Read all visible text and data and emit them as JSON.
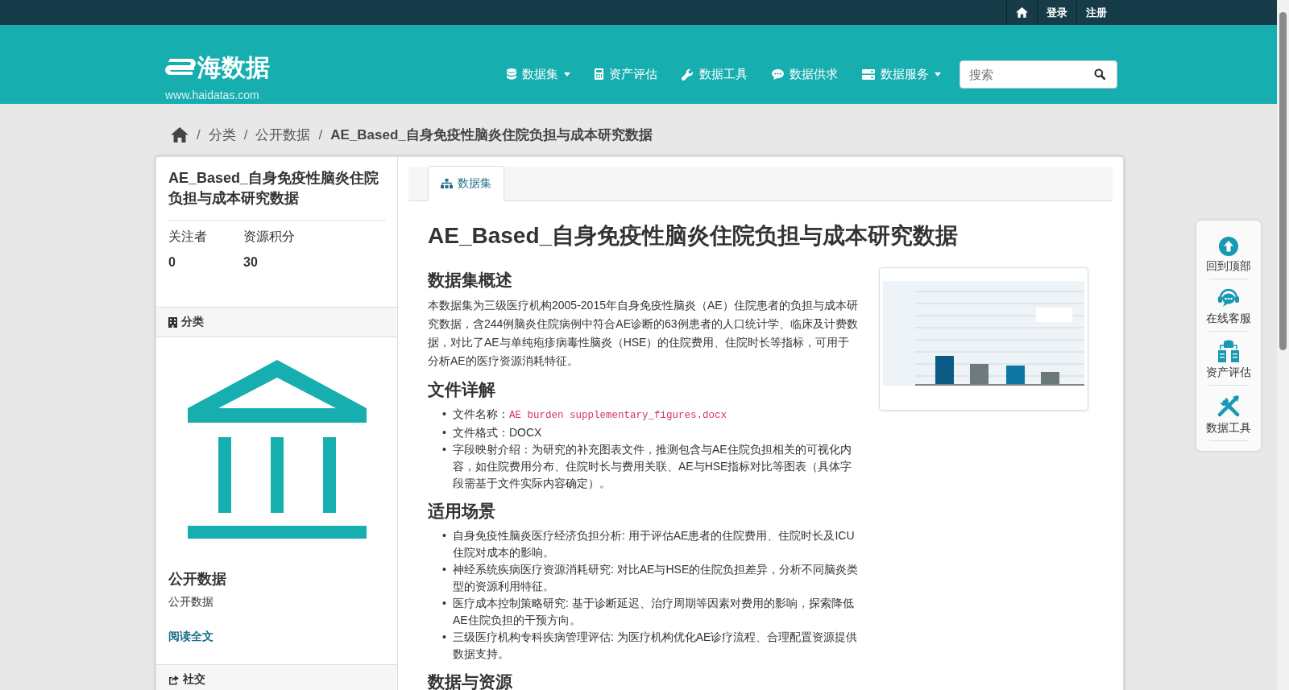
{
  "top_bar": {
    "links": [
      {
        "label": "登录"
      },
      {
        "label": "注册"
      }
    ]
  },
  "header": {
    "logo": "海数据",
    "url": "www.haidatas.com",
    "nav": [
      {
        "kind": "database",
        "label": "数据集",
        "dropdown": true
      },
      {
        "kind": "calculator",
        "label": "资产评估",
        "dropdown": false
      },
      {
        "kind": "wrench",
        "label": "数据工具",
        "dropdown": false
      },
      {
        "kind": "comment",
        "label": "数据供求",
        "dropdown": false
      },
      {
        "kind": "server",
        "label": "数据服务",
        "dropdown": true
      }
    ],
    "search": {
      "placeholder": "搜索"
    }
  },
  "breadcrumb": {
    "separator": "/",
    "items": [
      "分类",
      "公开数据",
      "AE_Based_自身免疫性脑炎住院负担与成本研究数据"
    ]
  },
  "sidebar": {
    "title": "AE_Based_自身免疫性脑炎住院负担与成本研究数据",
    "stats": [
      {
        "label": "关注者",
        "value": "0"
      },
      {
        "label": "资源积分",
        "value": "30"
      }
    ],
    "category_heading": "分类",
    "category_name": "公开数据",
    "category_text": "公开数据",
    "read_more": "阅读全文",
    "social_heading": "社交"
  },
  "main": {
    "tabs": [
      {
        "label": "数据集",
        "selected": true
      }
    ],
    "title": "AE_Based_自身免疫性脑炎住院负担与成本研究数据",
    "sections": [
      {
        "heading": "数据集概述",
        "kind": "paragraph",
        "text": "本数据集为三级医疗机构2005-2015年自身免疫性脑炎（AE）住院患者的负担与成本研究数据，含244例脑炎住院病例中符合AE诊断的63例患者的人口统计学、临床及计费数据，对比了AE与单纯疱疹病毒性脑炎（HSE）的住院费用、住院时长等指标，可用于分析AE的医疗资源消耗特征。"
      },
      {
        "heading": "文件详解",
        "kind": "list",
        "bullet": "•",
        "items": [
          {
            "text": "文件名称：",
            "code": "AE burden supplementary_figures.docx"
          },
          {
            "text": "文件格式：DOCX"
          },
          {
            "text": "字段映射介绍：为研究的补充图表文件，推测包含与AE住院负担相关的可视化内容，如住院费用分布、住院时长与费用关联、AE与HSE指标对比等图表（具体字段需基于文件实际内容确定）。"
          }
        ]
      },
      {
        "heading": "适用场景",
        "kind": "list",
        "bullet": "•",
        "items": [
          {
            "text": "自身免疫性脑炎医疗经济负担分析: 用于评估AE患者的住院费用、住院时长及ICU住院对成本的影响。"
          },
          {
            "text": "神经系统疾病医疗资源消耗研究: 对比AE与HSE的住院负担差异，分析不同脑炎类型的资源利用特征。"
          },
          {
            "text": "医疗成本控制策略研究: 基于诊断延迟、治疗周期等因素对费用的影响，探索降低AE住院负担的干预方向。"
          },
          {
            "text": "三级医疗机构专科疾病管理评估: 为医疗机构优化AE诊疗流程、合理配置资源提供数据支持。"
          }
        ]
      },
      {
        "heading": "数据与资源",
        "kind": "heading"
      }
    ]
  },
  "float_toolbar": [
    {
      "kind": "up",
      "label": "回到顶部"
    },
    {
      "kind": "chat",
      "label": "在线客服"
    },
    {
      "kind": "assets",
      "label": "资产评估"
    },
    {
      "kind": "tools",
      "label": "数据工具"
    }
  ]
}
